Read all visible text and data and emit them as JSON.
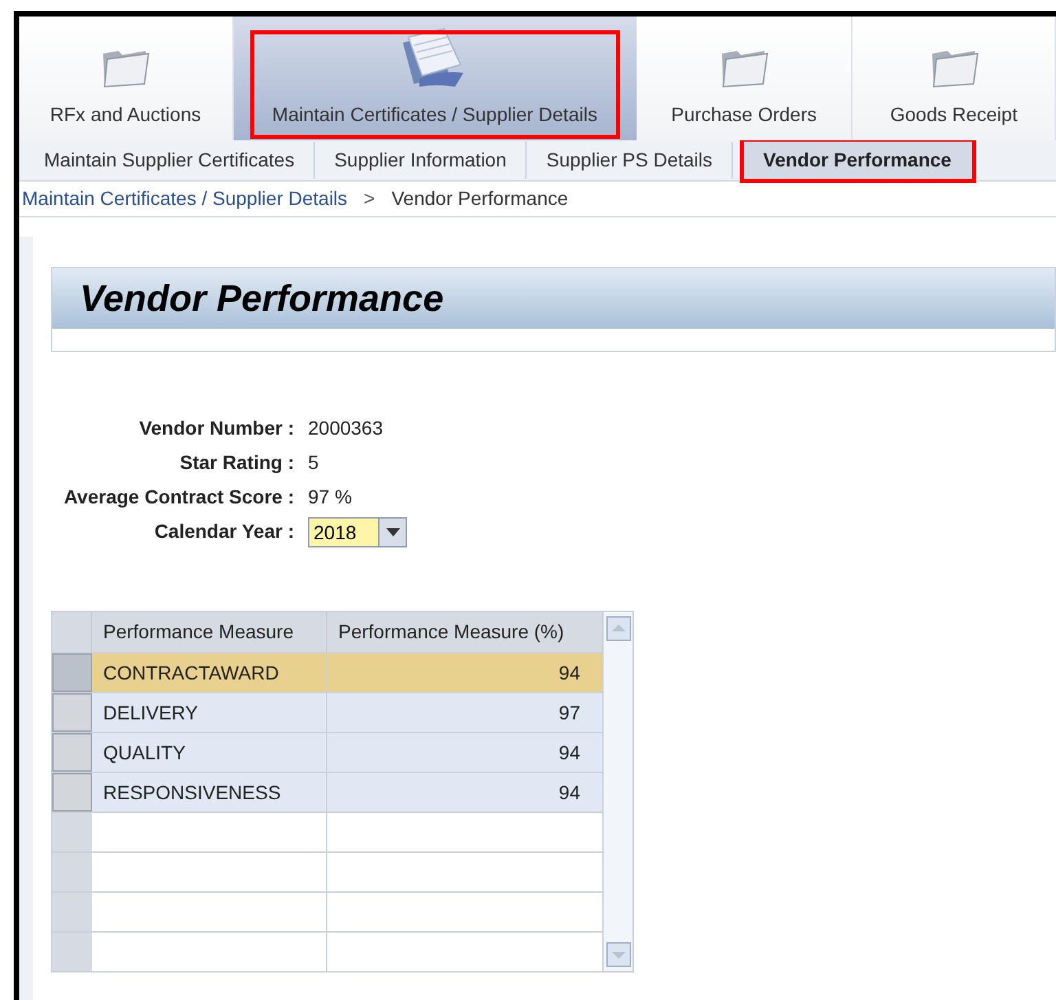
{
  "main_tabs": [
    {
      "label": "RFx and Auctions",
      "selected": false,
      "highlighted": false
    },
    {
      "label": "Maintain Certificates / Supplier Details",
      "selected": true,
      "highlighted": true
    },
    {
      "label": "Purchase Orders",
      "selected": false,
      "highlighted": false
    },
    {
      "label": "Goods Receipt",
      "selected": false,
      "highlighted": false
    }
  ],
  "sub_tabs": [
    {
      "label": "Maintain Supplier Certificates",
      "selected": false,
      "highlighted": false
    },
    {
      "label": "Supplier Information",
      "selected": false,
      "highlighted": false
    },
    {
      "label": "Supplier PS Details",
      "selected": false,
      "highlighted": false
    },
    {
      "label": "Vendor Performance",
      "selected": true,
      "highlighted": true
    }
  ],
  "breadcrumb": {
    "link": "Maintain Certificates / Supplier Details",
    "separator": ">",
    "current": "Vendor Performance"
  },
  "page_title": "Vendor Performance",
  "fields": [
    {
      "label": "Vendor Number :",
      "value": "2000363",
      "kind": "text"
    },
    {
      "label": "Star Rating :",
      "value": "5",
      "kind": "text"
    },
    {
      "label": "Average Contract Score :",
      "value": "97 %",
      "kind": "text"
    },
    {
      "label": "Calendar Year :",
      "value": "2018",
      "kind": "dropdown"
    }
  ],
  "table": {
    "columns": [
      "Performance Measure",
      "Performance Measure (%)"
    ],
    "rows": [
      {
        "measure": "CONTRACTAWARD",
        "percent": "94",
        "selected": true
      },
      {
        "measure": "DELIVERY",
        "percent": "97",
        "selected": false
      },
      {
        "measure": "QUALITY",
        "percent": "94",
        "selected": false
      },
      {
        "measure": "RESPONSIVENESS",
        "percent": "94",
        "selected": false
      }
    ]
  }
}
